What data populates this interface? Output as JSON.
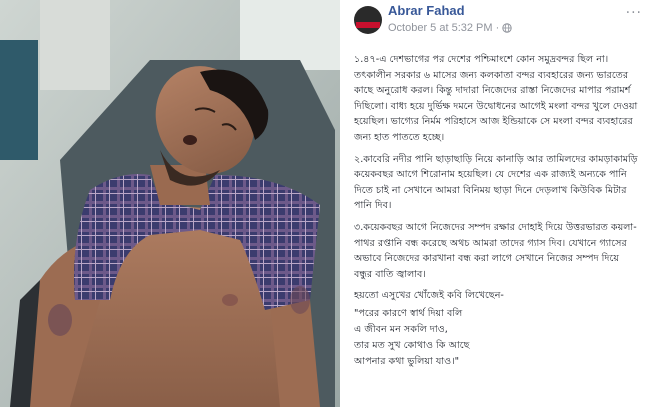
{
  "post": {
    "author": "Abrar Fahad",
    "date": "October 5 at 5:32 PM",
    "dot": "·",
    "paragraphs": [
      "১.৪৭-এ দেশভাগের পর দেশের পশ্চিমাংশে কোন সমুদ্রবন্দর ছিল না। তৎকালীন সরকার ৬ মাসের জন্য কলকাতা বন্দর ব্যবহারের জন্য ভারতের কাছে অনুরোধ করল। কিন্তু দাদারা নিজেদের রাস্তা নিজেদের মাপার পরামর্শ দিছিলো। বাধ্য হয়ে দুর্ভিক্ষ দমনে উদ্বোধনের আগেই মংলা বন্দর খুলে দেওয়া হয়েছিল। ভাগ্যের নির্মম পরিহাসে আজ ইন্ডিয়াকে সে মংলা বন্দর ব্যবহারের জন্য হাত পাততে হচ্ছে।",
      "২.কাবেরি নদীর পানি ছাড়াছাড়ি নিয়ে কানাড়ি আর তামিলদের কামড়াকামড়ি কয়েকবছর আগে শিরোনাম হয়েছিল। যে দেশের এক রাজ্যই অন্যকে পানি দিতে চাই না সেখানে আমরা বিনিময় ছাড়া দিনে দেড়লাখ কিউবিক মিটার পানি দিব।",
      "৩.কয়েকবছর আগে নিজেদের সম্পদ রক্ষার দোহাই দিয়ে উত্তরভারত কয়লা-পাথর রপ্তানি বন্ধ করেছে অথচ আমরা তাদের গ্যাস দিব। যেখানে গ্যাসের অভাবে নিজেদের কারখানা বন্ধ করা লাগে সেখানে নিজের সম্পদ দিয়ে বন্ধুর বাতি জ্বালাব।"
    ],
    "closing": "হয়তো এসুখের খোঁজেই কবি লিখেছেন-",
    "poem": [
      "\"পরের কারণে স্বার্থ দিয়া বলি",
      "এ জীবন মন সকলি দাও,",
      "তার মত সুখ কোথাও কি আছে",
      "আপনার কথা ভুলিয়া যাও।\""
    ]
  },
  "colors": {
    "author": "#385898",
    "meta": "#90949c",
    "text": "#1d2129"
  },
  "icons": [
    "avatar-image",
    "globe-icon",
    "options-icon"
  ]
}
